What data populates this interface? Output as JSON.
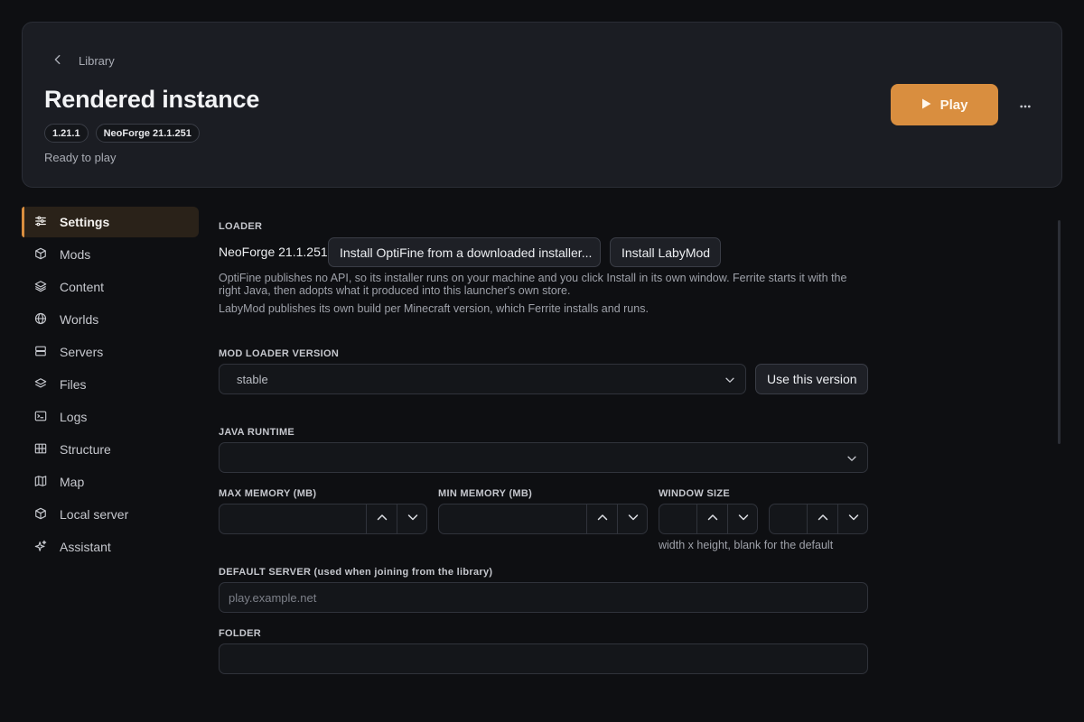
{
  "header": {
    "breadcrumb_label": "Library",
    "title": "Rendered instance",
    "badges": [
      "1.21.1",
      "NeoForge 21.1.251"
    ],
    "status": "Ready to play",
    "play_label": "Play"
  },
  "sidebar": {
    "items": [
      {
        "label": "Settings",
        "icon": "sliders-icon",
        "active": true
      },
      {
        "label": "Mods",
        "icon": "cube-icon"
      },
      {
        "label": "Content",
        "icon": "layers-icon"
      },
      {
        "label": "Worlds",
        "icon": "globe-icon"
      },
      {
        "label": "Servers",
        "icon": "server-icon"
      },
      {
        "label": "Files",
        "icon": "stack-icon"
      },
      {
        "label": "Logs",
        "icon": "terminal-icon"
      },
      {
        "label": "Structure",
        "icon": "grid-icon"
      },
      {
        "label": "Map",
        "icon": "map-icon"
      },
      {
        "label": "Local server",
        "icon": "cube-icon"
      },
      {
        "label": "Assistant",
        "icon": "sparkles-icon"
      }
    ]
  },
  "loader": {
    "section_label": "LOADER",
    "current": "NeoForge 21.1.251",
    "optifine_button": "Install OptiFine from a downloaded installer...",
    "labymod_button": "Install LabyMod",
    "optifine_help": "OptiFine publishes no API, so its installer runs on your machine and you click Install in its own window. Ferrite starts it with the right Java, then adopts what it produced into this launcher's own store.",
    "labymod_help": "LabyMod publishes its own build per Minecraft version, which Ferrite installs and runs."
  },
  "mod_loader_version": {
    "section_label": "MOD LOADER VERSION",
    "selected": "stable",
    "use_button": "Use this version"
  },
  "java_runtime": {
    "section_label": "JAVA RUNTIME",
    "selected": ""
  },
  "memory": {
    "max_label": "MAX MEMORY (MB)",
    "max_value": "",
    "min_label": "MIN MEMORY (MB)",
    "min_value": ""
  },
  "window_size": {
    "section_label": "WINDOW SIZE",
    "width": "",
    "height": "",
    "hint": "width x height, blank for the default"
  },
  "default_server": {
    "section_label": "DEFAULT SERVER (used when joining from the library)",
    "placeholder": "play.example.net",
    "value": ""
  },
  "folder": {
    "section_label": "FOLDER",
    "value": ""
  },
  "colors": {
    "accent": "#d98e3f",
    "background": "#0e0f12",
    "card": "#1b1d23"
  }
}
